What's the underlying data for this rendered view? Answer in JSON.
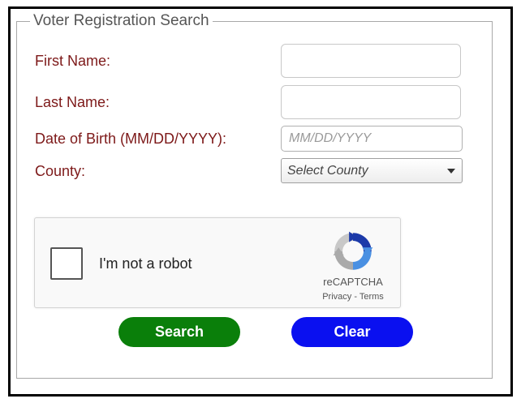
{
  "form": {
    "legend": "Voter Registration Search",
    "first_name_label": "First Name:",
    "first_name_value": "",
    "last_name_label": "Last Name:",
    "last_name_value": "",
    "dob_label": "Date of Birth (MM/DD/YYYY):",
    "dob_placeholder": "MM/DD/YYYY",
    "county_label": "County:",
    "county_selected": "Select County"
  },
  "captcha": {
    "checkbox_label": "I'm not a robot",
    "brand": "reCAPTCHA",
    "privacy_link": "Privacy",
    "separator": " - ",
    "terms_link": "Terms"
  },
  "buttons": {
    "search_label": "Search",
    "clear_label": "Clear"
  },
  "colors": {
    "label_text": "#7d1919",
    "search_button": "#0a7f0a",
    "clear_button": "#0a10f0"
  },
  "icons": {
    "captcha_logo": "recaptcha-logo-icon",
    "dropdown": "chevron-down-icon"
  }
}
